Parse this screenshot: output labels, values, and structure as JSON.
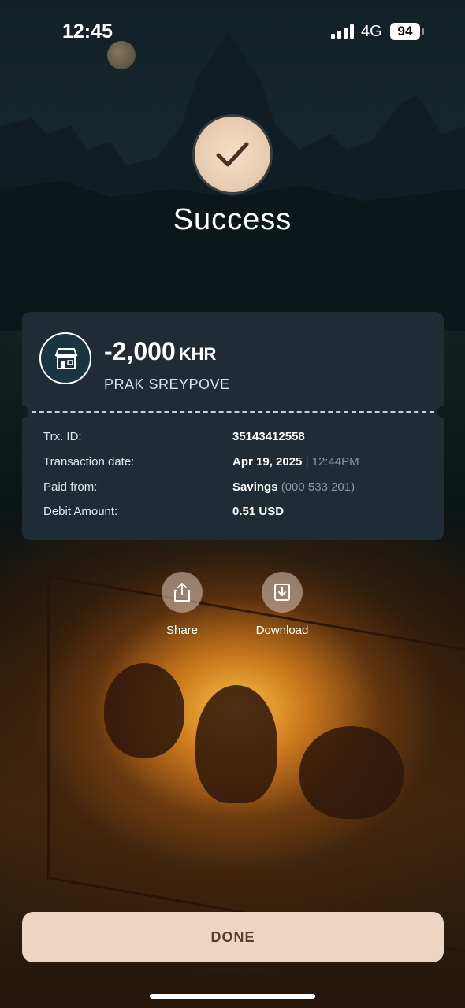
{
  "status_bar": {
    "time": "12:45",
    "network": "4G",
    "battery": "94"
  },
  "header": {
    "title": "Success"
  },
  "transaction": {
    "amount": "-2,000",
    "currency": "KHR",
    "merchant": "PRAK SREYPOVE",
    "details": [
      {
        "label": "Trx. ID:",
        "value": "35143412558",
        "extra": ""
      },
      {
        "label": "Transaction date:",
        "value": "Apr 19, 2025",
        "extra": "| 12:44PM"
      },
      {
        "label": "Paid from:",
        "value": "Savings",
        "extra": "(000 533 201)"
      },
      {
        "label": "Debit Amount:",
        "value": "0.51 USD",
        "extra": ""
      }
    ]
  },
  "actions": {
    "share": "Share",
    "download": "Download"
  },
  "done_label": "DONE",
  "icons": {
    "success": "checkmark-icon",
    "merchant": "store-icon",
    "share": "share-icon",
    "download": "download-icon"
  },
  "colors": {
    "card": "#1f2c36",
    "badge": "#ecd5c2",
    "done_text": "#5b3e2c",
    "muted_text": "#8a96a0"
  }
}
